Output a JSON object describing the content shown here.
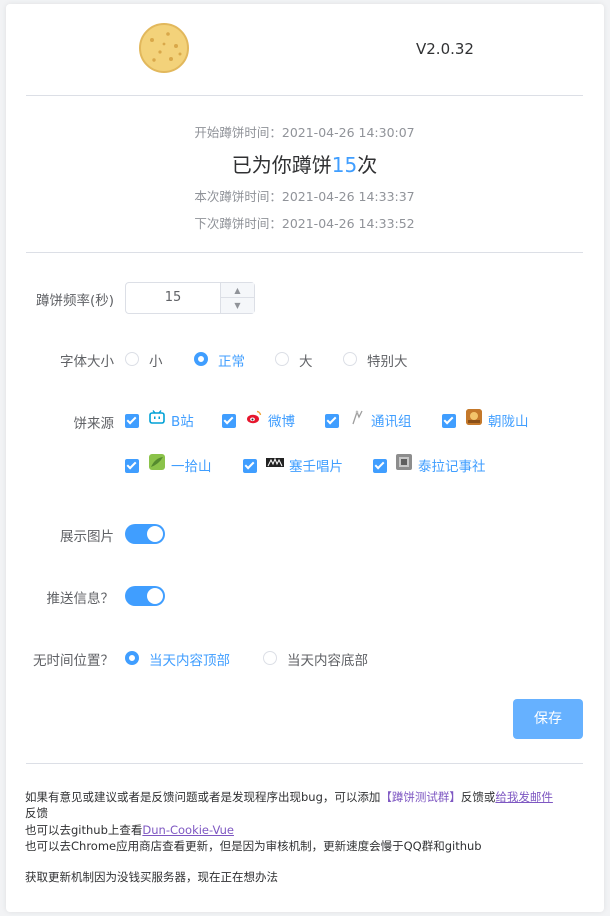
{
  "header": {
    "version": "V2.0.32"
  },
  "stats": {
    "start_label": "开始蹲饼时间：",
    "start_time": "2021-04-26 14:30:07",
    "headline_prefix": "已为你蹲饼",
    "headline_count": "15",
    "headline_suffix": "次",
    "this_label": "本次蹲饼时间：",
    "this_time": "2021-04-26 14:33:37",
    "next_label": "下次蹲饼时间：",
    "next_time": "2021-04-26 14:33:52"
  },
  "form": {
    "frequency": {
      "label": "蹲饼频率(秒)",
      "value": "15"
    },
    "font_size": {
      "label": "字体大小",
      "options": [
        "小",
        "正常",
        "大",
        "特别大"
      ],
      "selected": "正常"
    },
    "sources": {
      "label": "饼来源",
      "items": [
        {
          "name": "B站",
          "checked": true,
          "icon": "bilibili-icon",
          "color": "#00a1d6"
        },
        {
          "name": "微博",
          "checked": true,
          "icon": "weibo-icon",
          "color": "#e6162d"
        },
        {
          "name": "通讯组",
          "checked": true,
          "icon": "telegram-group-icon",
          "color": "#9e9e9e"
        },
        {
          "name": "朝陇山",
          "checked": true,
          "icon": "chaolongshan-icon",
          "color": "#d08a2e"
        },
        {
          "name": "一拾山",
          "checked": true,
          "icon": "yishishan-icon",
          "color": "#7cc243"
        },
        {
          "name": "塞壬唱片",
          "checked": true,
          "icon": "siren-records-icon",
          "color": "#222222"
        },
        {
          "name": "泰拉记事社",
          "checked": true,
          "icon": "terra-journal-icon",
          "color": "#8d8d8d"
        }
      ]
    },
    "show_image": {
      "label": "展示图片",
      "on": true
    },
    "push_info": {
      "label": "推送信息？",
      "on": true
    },
    "no_time_position": {
      "label": "无时间位置？",
      "options": [
        "当天内容顶部",
        "当天内容底部"
      ],
      "selected": "当天内容顶部"
    },
    "save_label": "保存"
  },
  "footer": {
    "line1_text": "如果有意见或建议或者是反馈问题或者是发现程序出现bug，可以添加",
    "group_link": "【蹲饼测试群】",
    "line1_mid": "反馈或",
    "mail_link": "给我发邮件",
    "line1_end": "反馈",
    "line2_text": "也可以去github上查看",
    "github_link": "Dun-Cookie-Vue",
    "line3_text": "也可以去Chrome应用商店查看更新，但是因为审核机制，更新速度会慢于QQ群和github",
    "line4_text": "获取更新机制因为没钱买服务器，现在正在想办法"
  },
  "colors": {
    "accent": "#409eff",
    "button": "#66b1ff"
  }
}
